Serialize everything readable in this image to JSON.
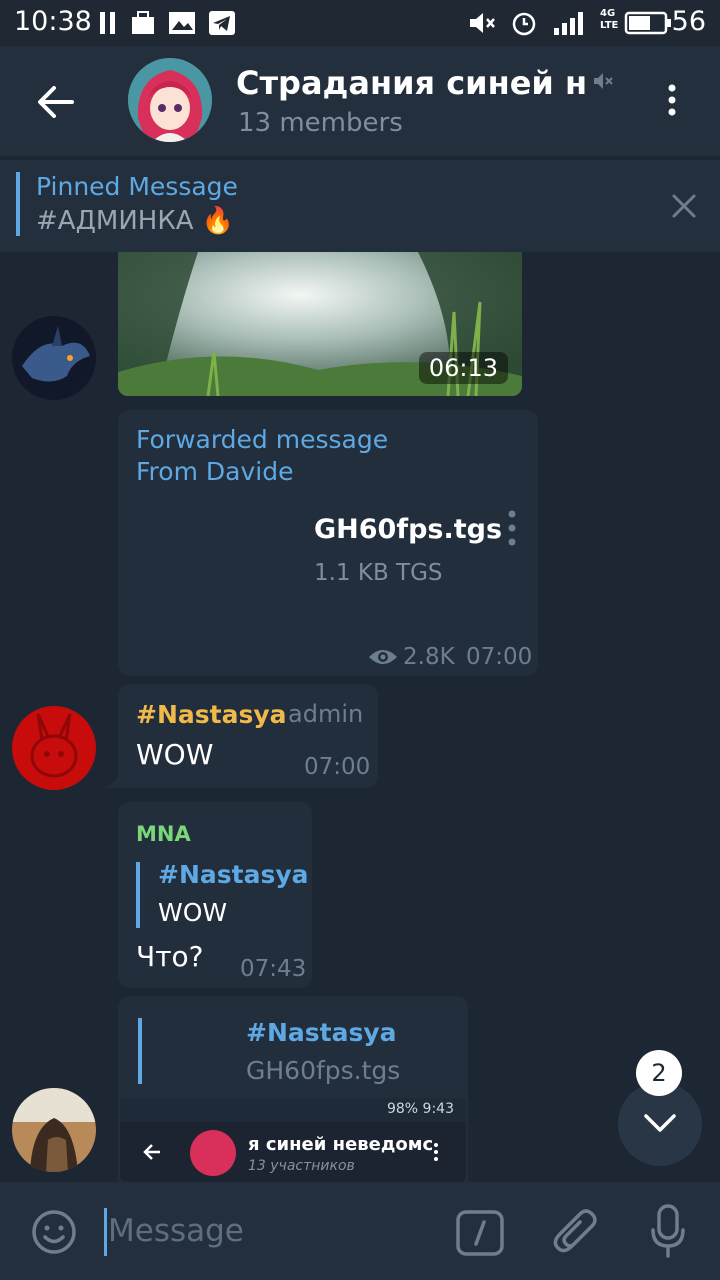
{
  "status_bar": {
    "time": "10:38",
    "battery": "56",
    "network": "4G LTE"
  },
  "header": {
    "title": "Страдания синей н…",
    "subtitle": "13 members"
  },
  "pinned": {
    "label": "Pinned Message",
    "text": "#АДМИНКА 🔥"
  },
  "messages": {
    "video": {
      "duration": "06:13"
    },
    "forwarded": {
      "line1": "Forwarded message",
      "line2": "From Davide",
      "file_name": "GH60fps.tgs",
      "file_meta": "1.1 KB TGS",
      "views": "2.8K",
      "time": "07:00"
    },
    "nastasya": {
      "sender": "#Nastasya",
      "role": "admin",
      "text": "WOW",
      "time": "07:00"
    },
    "mna": {
      "sender": "MNA",
      "reply_sender": "#Nastasya",
      "reply_text": "WOW",
      "text": "Что?",
      "time": "07:43"
    },
    "last": {
      "reply_sender": "#Nastasya",
      "reply_text": "GH60fps.tgs",
      "shot_status": "98%  9:43",
      "shot_title": "я синей неведомс",
      "shot_subtitle": "13 участников"
    }
  },
  "scroll_badge": "2",
  "input": {
    "placeholder": "Message"
  },
  "colors": {
    "accent": "#5ea8e3",
    "bg": "#1d2733",
    "bubble": "#222e3c",
    "nastasya": "#f0b94a",
    "mna": "#7ad67a"
  }
}
